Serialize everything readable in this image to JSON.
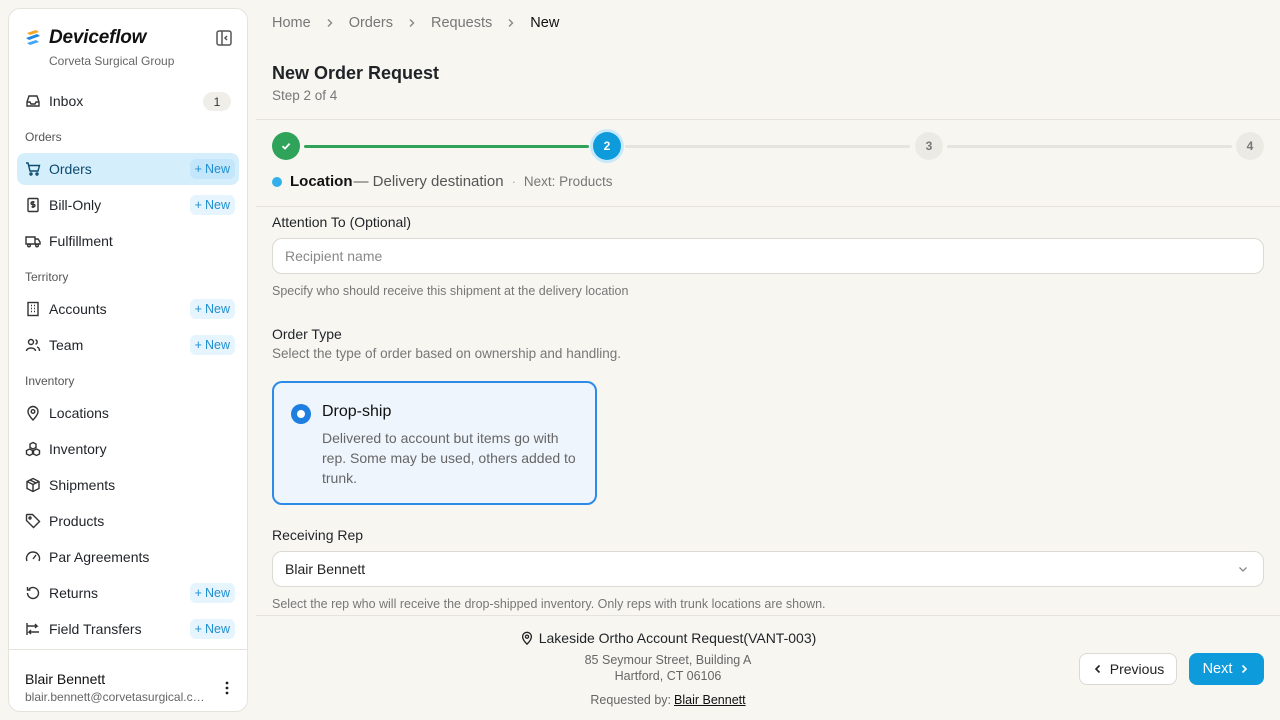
{
  "brand": {
    "name": "Deviceflow",
    "org": "Corveta Surgical Group"
  },
  "sidebar": {
    "inbox": {
      "label": "Inbox",
      "count": "1"
    },
    "sections": {
      "orders": "Orders",
      "territory": "Territory",
      "inventory": "Inventory"
    },
    "new_label": "New",
    "items": {
      "orders": "Orders",
      "bill_only": "Bill-Only",
      "fulfillment": "Fulfillment",
      "accounts": "Accounts",
      "team": "Team",
      "locations": "Locations",
      "inventory": "Inventory",
      "shipments": "Shipments",
      "products": "Products",
      "par_agreements": "Par Agreements",
      "returns": "Returns",
      "field_transfers": "Field Transfers"
    },
    "user": {
      "name": "Blair Bennett",
      "email": "blair.bennett@corvetasurgical.com"
    }
  },
  "breadcrumb": [
    "Home",
    "Orders",
    "Requests",
    "New"
  ],
  "page": {
    "title": "New Order Request",
    "step": "Step 2 of 4"
  },
  "stepper": {
    "steps": [
      "1",
      "2",
      "3",
      "4"
    ],
    "current": {
      "name": "Location",
      "desc": "— Delivery destination",
      "separator": "·",
      "next": "Next: Products"
    },
    "colors": {
      "done": "#2fa35a",
      "current": "#0e9bdc"
    }
  },
  "form": {
    "attention": {
      "label": "Attention To (Optional)",
      "placeholder": "Recipient name",
      "help": "Specify who should receive this shipment at the delivery location"
    },
    "order_type": {
      "label": "Order Type",
      "help": "Select the type of order based on ownership and handling.",
      "option": {
        "title": "Drop-ship",
        "desc": "Delivered to account but items go with rep. Some may be used, others added to trunk."
      }
    },
    "receiving_rep": {
      "label": "Receiving Rep",
      "value": "Blair Bennett",
      "help": "Select the rep who will receive the drop-shipped inventory. Only reps with trunk locations are shown."
    }
  },
  "footer": {
    "location": "Lakeside Ortho Account Request(VANT-003)",
    "address_line1": "85 Seymour Street, Building A",
    "address_line2": "Hartford, CT 06106",
    "requested_by_label": "Requested by:",
    "requested_by": "Blair Bennett",
    "prev": "Previous",
    "next": "Next"
  }
}
